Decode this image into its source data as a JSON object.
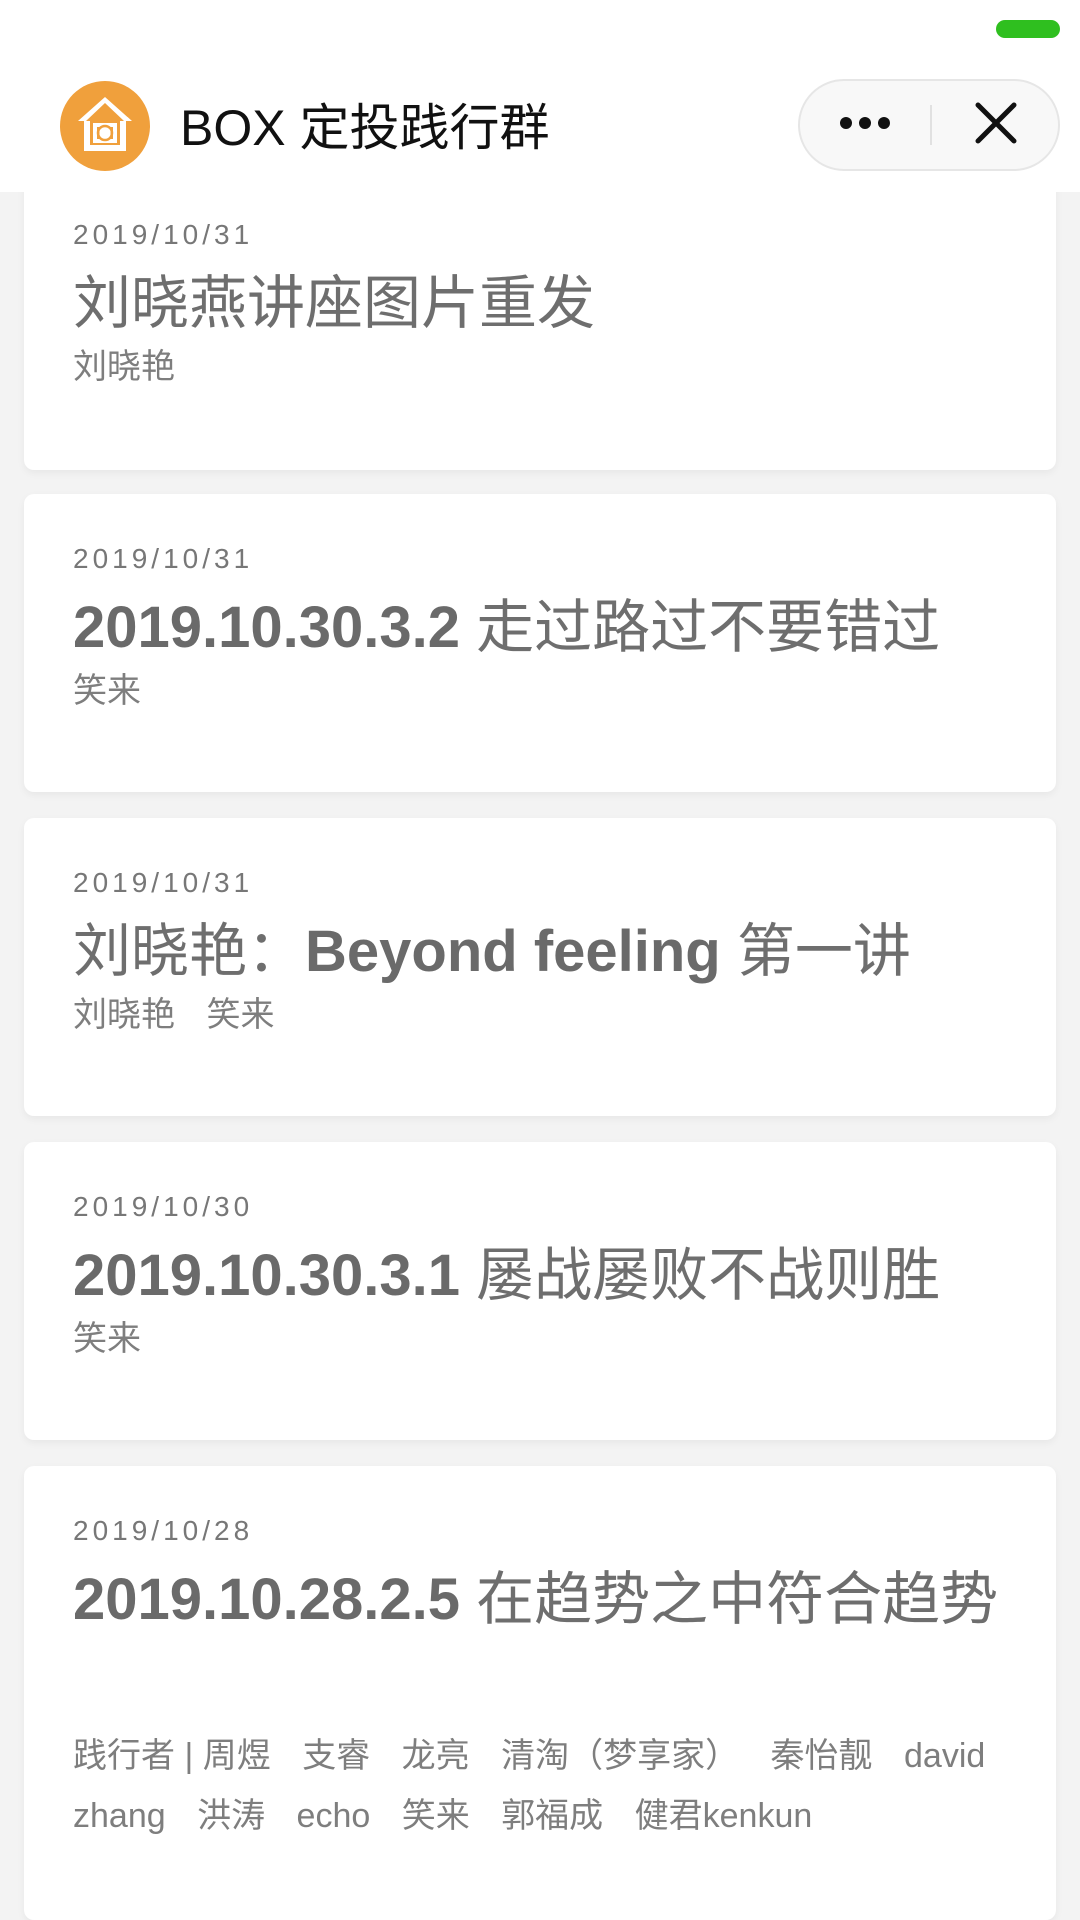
{
  "header": {
    "title": "BOX 定投践行群",
    "logo_icon": "house-coin-icon",
    "more_icon": "more-dots-icon",
    "close_icon": "close-icon",
    "brand_color": "#F0A03C",
    "status_color": "#2FBF1F"
  },
  "posts": [
    {
      "date": "2019/10/31",
      "title": "刘晓燕讲座图片重发",
      "title_num": "",
      "authors": [
        "刘晓艳"
      ]
    },
    {
      "date": "2019/10/31",
      "title_num": "2019.10.30.3.2",
      "title": " 走过路过不要错过",
      "authors": [
        "笑来"
      ]
    },
    {
      "date": "2019/10/31",
      "title": "刘晓艳：",
      "title_num": "Beyond feeling",
      "title_tail": " 第一讲",
      "authors": [
        "刘晓艳",
        "笑来"
      ]
    },
    {
      "date": "2019/10/30",
      "title_num": "2019.10.30.3.1",
      "title": " 屡战屡败不战则胜",
      "authors": [
        "笑来"
      ]
    },
    {
      "date": "2019/10/28",
      "title_num": "2019.10.28.2.5",
      "title": " 在趋势之中符合趋势",
      "authors": [
        "践行者 | 周煜",
        "支睿",
        "龙亮",
        "清淘（梦享家）",
        "秦怡靓",
        "david zhang",
        "洪涛",
        "echo",
        "笑来",
        "郭福成",
        "健君kenkun"
      ]
    }
  ]
}
